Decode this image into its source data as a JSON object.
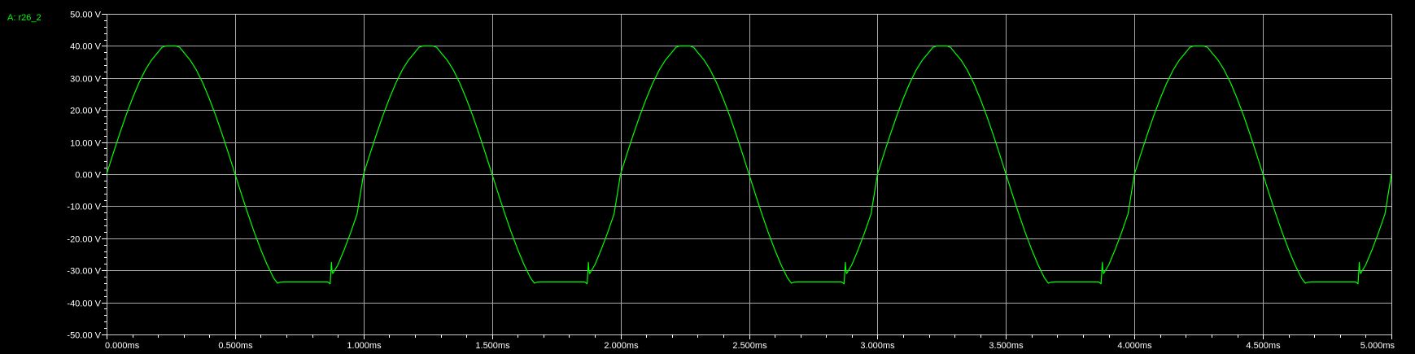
{
  "trace": {
    "label": "A: r26_2",
    "color": "#00ff00"
  },
  "chart_data": {
    "type": "line",
    "title": "",
    "xlabel": "",
    "ylabel": "",
    "xlim": [
      0,
      5
    ],
    "ylim": [
      -50,
      50
    ],
    "grid": true,
    "x_ticks": [
      0,
      0.5,
      1,
      1.5,
      2,
      2.5,
      3,
      3.5,
      4,
      4.5,
      5
    ],
    "x_tick_labels": [
      "0.000ms",
      "0.500ms",
      "1.000ms",
      "1.500ms",
      "2.000ms",
      "2.500ms",
      "3.000ms",
      "3.500ms",
      "4.000ms",
      "4.500ms",
      "5.000ms"
    ],
    "y_ticks": [
      50,
      40,
      30,
      20,
      10,
      0,
      -10,
      -20,
      -30,
      -40,
      -50
    ],
    "y_tick_labels": [
      "50.00 V",
      "40.00 V",
      "30.00 V",
      "20.00 V",
      "10.00 V",
      "0.00 V",
      "-10.00 V",
      "-20.00 V",
      "-30.00 V",
      "-40.00 V",
      "-50.00 V"
    ],
    "series": [
      {
        "name": "A: r26_2",
        "color": "#00ff00",
        "x_unit": "ms",
        "y_unit": "V",
        "points": [
          [
            0.0,
            0.0
          ],
          [
            0.025,
            6.3
          ],
          [
            0.05,
            12.4
          ],
          [
            0.075,
            18.2
          ],
          [
            0.1,
            23.5
          ],
          [
            0.125,
            28.3
          ],
          [
            0.15,
            32.4
          ],
          [
            0.175,
            35.6
          ],
          [
            0.2,
            38.0
          ],
          [
            0.215,
            39.5
          ],
          [
            0.23,
            40.0
          ],
          [
            0.27,
            40.0
          ],
          [
            0.285,
            39.5
          ],
          [
            0.3,
            38.0
          ],
          [
            0.325,
            35.6
          ],
          [
            0.35,
            32.4
          ],
          [
            0.375,
            28.3
          ],
          [
            0.4,
            23.5
          ],
          [
            0.425,
            18.2
          ],
          [
            0.45,
            12.4
          ],
          [
            0.475,
            6.3
          ],
          [
            0.5,
            0.0
          ],
          [
            0.525,
            -6.3
          ],
          [
            0.55,
            -12.4
          ],
          [
            0.575,
            -18.2
          ],
          [
            0.6,
            -23.5
          ],
          [
            0.625,
            -28.3
          ],
          [
            0.65,
            -32.4
          ],
          [
            0.665,
            -34.0
          ],
          [
            0.675,
            -33.7
          ],
          [
            0.69,
            -33.6
          ],
          [
            0.86,
            -33.6
          ],
          [
            0.87,
            -34.2
          ],
          [
            0.873,
            -30.5
          ],
          [
            0.875,
            -27.5
          ],
          [
            0.877,
            -30.0
          ],
          [
            0.88,
            -31.0
          ],
          [
            0.9,
            -28.3
          ],
          [
            0.925,
            -23.5
          ],
          [
            0.95,
            -18.2
          ],
          [
            0.975,
            -12.4
          ],
          [
            1.0,
            0.0
          ],
          [
            1.025,
            6.3
          ],
          [
            1.05,
            12.4
          ],
          [
            1.075,
            18.2
          ],
          [
            1.1,
            23.5
          ],
          [
            1.125,
            28.3
          ],
          [
            1.15,
            32.4
          ],
          [
            1.175,
            35.6
          ],
          [
            1.2,
            38.0
          ],
          [
            1.215,
            39.5
          ],
          [
            1.23,
            40.0
          ],
          [
            1.27,
            40.0
          ],
          [
            1.285,
            39.5
          ],
          [
            1.3,
            38.0
          ],
          [
            1.325,
            35.6
          ],
          [
            1.35,
            32.4
          ],
          [
            1.375,
            28.3
          ],
          [
            1.4,
            23.5
          ],
          [
            1.425,
            18.2
          ],
          [
            1.45,
            12.4
          ],
          [
            1.475,
            6.3
          ],
          [
            1.5,
            0.0
          ],
          [
            1.525,
            -6.3
          ],
          [
            1.55,
            -12.4
          ],
          [
            1.575,
            -18.2
          ],
          [
            1.6,
            -23.5
          ],
          [
            1.625,
            -28.3
          ],
          [
            1.65,
            -32.4
          ],
          [
            1.665,
            -34.0
          ],
          [
            1.675,
            -33.7
          ],
          [
            1.69,
            -33.6
          ],
          [
            1.86,
            -33.6
          ],
          [
            1.87,
            -34.2
          ],
          [
            1.873,
            -30.5
          ],
          [
            1.875,
            -27.5
          ],
          [
            1.877,
            -30.0
          ],
          [
            1.88,
            -31.0
          ],
          [
            1.9,
            -28.3
          ],
          [
            1.925,
            -23.5
          ],
          [
            1.95,
            -18.2
          ],
          [
            1.975,
            -12.4
          ],
          [
            2.0,
            0.0
          ],
          [
            2.025,
            6.3
          ],
          [
            2.05,
            12.4
          ],
          [
            2.075,
            18.2
          ],
          [
            2.1,
            23.5
          ],
          [
            2.125,
            28.3
          ],
          [
            2.15,
            32.4
          ],
          [
            2.175,
            35.6
          ],
          [
            2.2,
            38.0
          ],
          [
            2.215,
            39.5
          ],
          [
            2.23,
            40.0
          ],
          [
            2.27,
            40.0
          ],
          [
            2.285,
            39.5
          ],
          [
            2.3,
            38.0
          ],
          [
            2.325,
            35.6
          ],
          [
            2.35,
            32.4
          ],
          [
            2.375,
            28.3
          ],
          [
            2.4,
            23.5
          ],
          [
            2.425,
            18.2
          ],
          [
            2.45,
            12.4
          ],
          [
            2.475,
            6.3
          ],
          [
            2.5,
            0.0
          ],
          [
            2.525,
            -6.3
          ],
          [
            2.55,
            -12.4
          ],
          [
            2.575,
            -18.2
          ],
          [
            2.6,
            -23.5
          ],
          [
            2.625,
            -28.3
          ],
          [
            2.65,
            -32.4
          ],
          [
            2.665,
            -34.0
          ],
          [
            2.675,
            -33.7
          ],
          [
            2.69,
            -33.6
          ],
          [
            2.86,
            -33.6
          ],
          [
            2.87,
            -34.2
          ],
          [
            2.873,
            -30.5
          ],
          [
            2.875,
            -27.5
          ],
          [
            2.877,
            -30.0
          ],
          [
            2.88,
            -31.0
          ],
          [
            2.9,
            -28.3
          ],
          [
            2.925,
            -23.5
          ],
          [
            2.95,
            -18.2
          ],
          [
            2.975,
            -12.4
          ],
          [
            3.0,
            0.0
          ],
          [
            3.025,
            6.3
          ],
          [
            3.05,
            12.4
          ],
          [
            3.075,
            18.2
          ],
          [
            3.1,
            23.5
          ],
          [
            3.125,
            28.3
          ],
          [
            3.15,
            32.4
          ],
          [
            3.175,
            35.6
          ],
          [
            3.2,
            38.0
          ],
          [
            3.215,
            39.5
          ],
          [
            3.23,
            40.0
          ],
          [
            3.27,
            40.0
          ],
          [
            3.285,
            39.5
          ],
          [
            3.3,
            38.0
          ],
          [
            3.325,
            35.6
          ],
          [
            3.35,
            32.4
          ],
          [
            3.375,
            28.3
          ],
          [
            3.4,
            23.5
          ],
          [
            3.425,
            18.2
          ],
          [
            3.45,
            12.4
          ],
          [
            3.475,
            6.3
          ],
          [
            3.5,
            0.0
          ],
          [
            3.525,
            -6.3
          ],
          [
            3.55,
            -12.4
          ],
          [
            3.575,
            -18.2
          ],
          [
            3.6,
            -23.5
          ],
          [
            3.625,
            -28.3
          ],
          [
            3.65,
            -32.4
          ],
          [
            3.665,
            -34.0
          ],
          [
            3.675,
            -33.7
          ],
          [
            3.69,
            -33.6
          ],
          [
            3.86,
            -33.6
          ],
          [
            3.87,
            -34.2
          ],
          [
            3.873,
            -30.5
          ],
          [
            3.875,
            -27.5
          ],
          [
            3.877,
            -30.0
          ],
          [
            3.88,
            -31.0
          ],
          [
            3.9,
            -28.3
          ],
          [
            3.925,
            -23.5
          ],
          [
            3.95,
            -18.2
          ],
          [
            3.975,
            -12.4
          ],
          [
            4.0,
            0.0
          ],
          [
            4.025,
            6.3
          ],
          [
            4.05,
            12.4
          ],
          [
            4.075,
            18.2
          ],
          [
            4.1,
            23.5
          ],
          [
            4.125,
            28.3
          ],
          [
            4.15,
            32.4
          ],
          [
            4.175,
            35.6
          ],
          [
            4.2,
            38.0
          ],
          [
            4.215,
            39.5
          ],
          [
            4.23,
            40.0
          ],
          [
            4.27,
            40.0
          ],
          [
            4.285,
            39.5
          ],
          [
            4.3,
            38.0
          ],
          [
            4.325,
            35.6
          ],
          [
            4.35,
            32.4
          ],
          [
            4.375,
            28.3
          ],
          [
            4.4,
            23.5
          ],
          [
            4.425,
            18.2
          ],
          [
            4.45,
            12.4
          ],
          [
            4.475,
            6.3
          ],
          [
            4.5,
            0.0
          ],
          [
            4.525,
            -6.3
          ],
          [
            4.55,
            -12.4
          ],
          [
            4.575,
            -18.2
          ],
          [
            4.6,
            -23.5
          ],
          [
            4.625,
            -28.3
          ],
          [
            4.65,
            -32.4
          ],
          [
            4.665,
            -34.0
          ],
          [
            4.675,
            -33.7
          ],
          [
            4.69,
            -33.6
          ],
          [
            4.86,
            -33.6
          ],
          [
            4.87,
            -34.2
          ],
          [
            4.873,
            -30.5
          ],
          [
            4.875,
            -27.5
          ],
          [
            4.877,
            -30.0
          ],
          [
            4.88,
            -31.0
          ],
          [
            4.9,
            -28.3
          ],
          [
            4.925,
            -23.5
          ],
          [
            4.95,
            -18.2
          ],
          [
            4.975,
            -12.4
          ],
          [
            5.0,
            0.0
          ]
        ]
      }
    ]
  }
}
